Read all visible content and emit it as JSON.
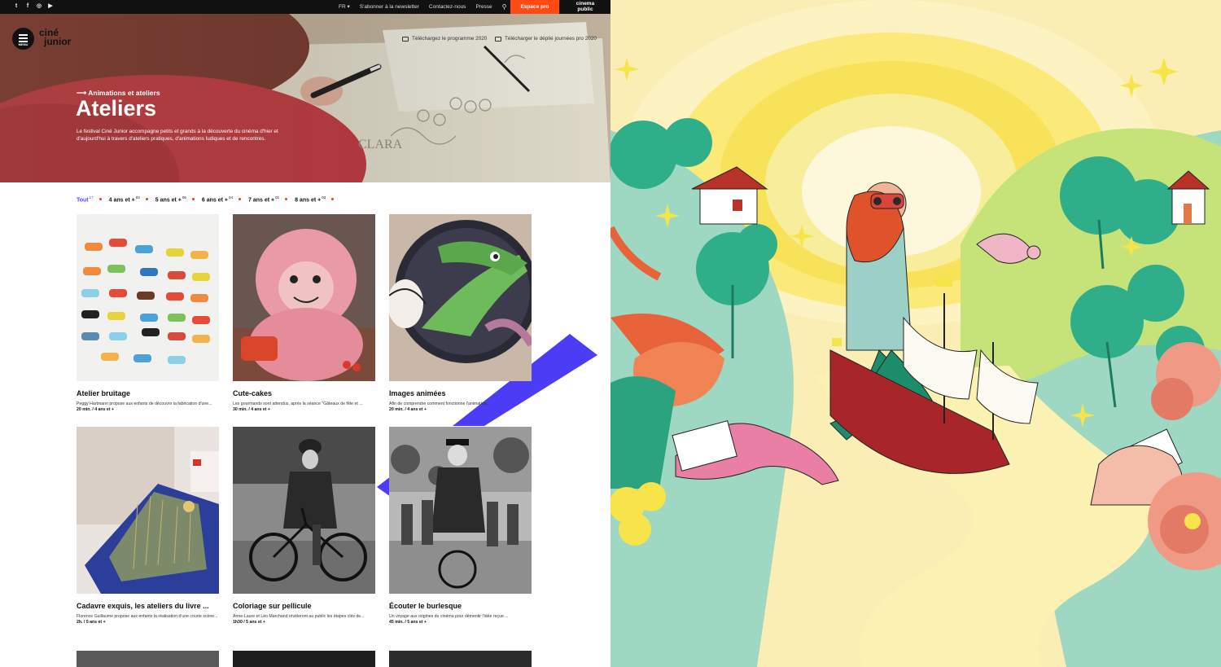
{
  "topbar": {
    "social": [
      "twitter-icon",
      "facebook-icon",
      "instagram-icon",
      "youtube-icon"
    ],
    "lang": "FR",
    "links": [
      "S'abonner à la newsletter",
      "Contactez-nous",
      "Presse"
    ],
    "pro_label": "Espace pro",
    "partner": [
      "cinema",
      "public"
    ]
  },
  "header": {
    "menu_label": "MENU",
    "logo": [
      "ciné",
      "junior"
    ],
    "download_program": "Téléchargez le programme 2020",
    "download_pro": "Télécharger le déplié journées pro 2020"
  },
  "hero": {
    "breadcrumb": "Animations et ateliers",
    "title": "Ateliers",
    "intro": "Le festival Ciné Junior accompagne petits et grands à la découverte du cinéma d'hier et d'aujourd'hui à travers d'ateliers pratiques, d'animations ludiques et de rencontres."
  },
  "filters": [
    {
      "label": "Tout",
      "count": "17",
      "active": true
    },
    {
      "label": "4 ans et +",
      "count": "03",
      "active": false
    },
    {
      "label": "5 ans et +",
      "count": "06",
      "active": false
    },
    {
      "label": "6 ans et +",
      "count": "04",
      "active": false
    },
    {
      "label": "7 ans et +",
      "count": "01",
      "active": false
    },
    {
      "label": "8 ans et +",
      "count": "03",
      "active": false
    }
  ],
  "cards": [
    {
      "title": "Atelier bruitage",
      "desc": "Peggy Hartmann propose aux enfants de découvrir la fabrication d'une...",
      "meta": "20 min. / 4 ans et +"
    },
    {
      "title": "Cute-cakes",
      "desc": "Les gourmands sont attendus, après la séance \"Gâteaux de fête et ...",
      "meta": "30 min. / 4 ans et +"
    },
    {
      "title": "Images animées",
      "desc": "Afin de comprendre comment fonctionne l'animation...",
      "meta": "20 min. / 4 ans et +"
    },
    {
      "title": "Cadavre exquis, les ateliers du livre ...",
      "desc": "Florence Guillaume propose aux enfants la réalisation d'une courte scène...",
      "meta": "2h. / 5 ans et +"
    },
    {
      "title": "Coloriage sur pellicule",
      "desc": "Anne-Laure et Léo Marchand révèleront au public les étapes clés de...",
      "meta": "1h30 / 5 ans et +"
    },
    {
      "title": "Écouter le burlesque",
      "desc": "Un voyage aux origines du cinéma pour démentir l'idée reçue ...",
      "meta": "45 min. / 5 ans et +"
    }
  ],
  "colors": {
    "accent": "#ff4a14",
    "filter_active": "#5046ff",
    "stripe": "#4b3cf5",
    "dot": "#e63b1f"
  }
}
